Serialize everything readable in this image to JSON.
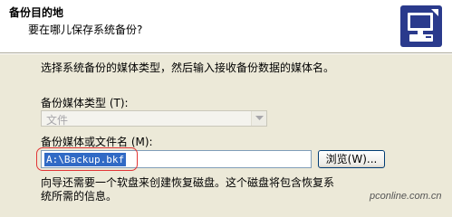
{
  "header": {
    "title": "备份目的地",
    "subtitle": "要在哪儿保存系统备份?",
    "icon": "backup-wizard-computer-icon"
  },
  "body": {
    "description": "选择系统备份的媒体类型，然后输入接收备份数据的媒体名。",
    "media_type_label": "备份媒体类型 (T):",
    "media_type_value": "文件",
    "media_name_label": "备份媒体或文件名 (M):",
    "media_name_value": "A:\\Backup.bkf",
    "browse_label": "浏览(W)...",
    "note": "向导还需要一个软盘来创建恢复磁盘。这个磁盘将包含恢复系统所需的信息。"
  },
  "watermark": "pconline.com.cn",
  "colors": {
    "highlight": "#E23535",
    "selection": "#316AC5",
    "dialog_background": "#ECE9D8"
  }
}
